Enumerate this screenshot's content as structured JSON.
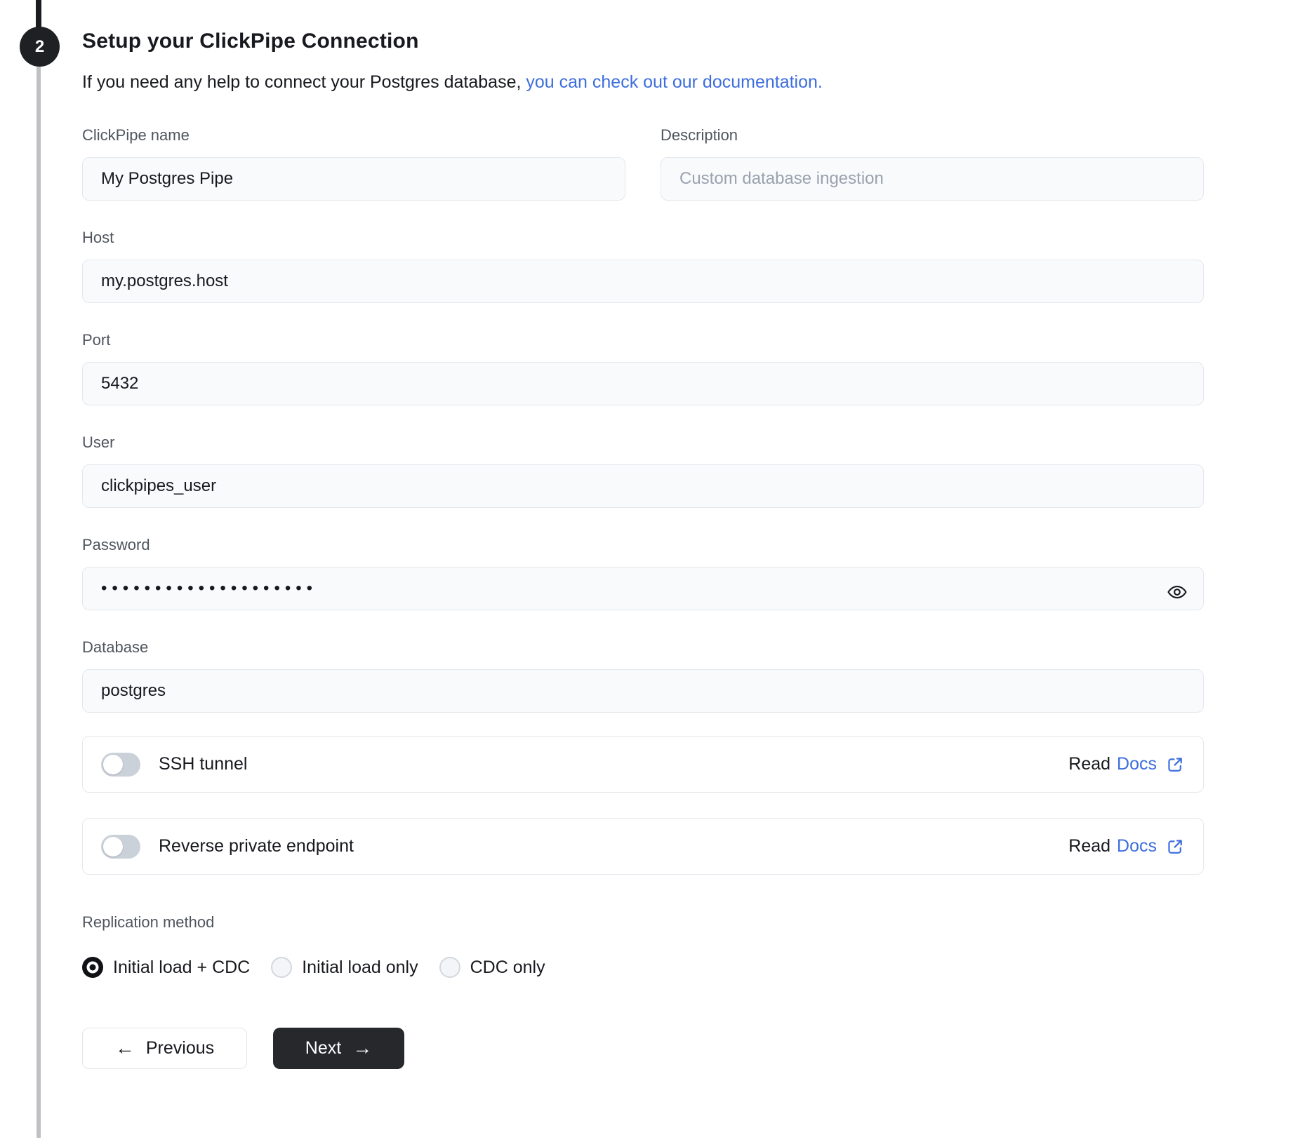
{
  "step": {
    "number": "2"
  },
  "header": {
    "title": "Setup your ClickPipe Connection",
    "subtitle_plain": "If you need any help to connect your Postgres database, ",
    "subtitle_link": "you can check out our documentation."
  },
  "form": {
    "clickpipe_name": {
      "label": "ClickPipe name",
      "value": "My Postgres Pipe"
    },
    "description": {
      "label": "Description",
      "placeholder": "Custom database ingestion"
    },
    "host": {
      "label": "Host",
      "value": "my.postgres.host"
    },
    "port": {
      "label": "Port",
      "value": "5432"
    },
    "user": {
      "label": "User",
      "value": "clickpipes_user"
    },
    "password": {
      "label": "Password",
      "masked_value": "••••••••••••••••••••",
      "reveal_icon": "eye-icon"
    },
    "database": {
      "label": "Database",
      "value": "postgres"
    }
  },
  "toggles": [
    {
      "label": "SSH tunnel",
      "state": "off",
      "read_label": "Read",
      "docs_label": "Docs",
      "icon": "external-link-icon"
    },
    {
      "label": "Reverse private endpoint",
      "state": "off",
      "read_label": "Read",
      "docs_label": "Docs",
      "icon": "external-link-icon"
    }
  ],
  "replication": {
    "label": "Replication method",
    "options": [
      {
        "label": "Initial load + CDC",
        "selected": true
      },
      {
        "label": "Initial load only",
        "selected": false
      },
      {
        "label": "CDC only",
        "selected": false
      }
    ]
  },
  "buttons": {
    "previous": {
      "label": "Previous",
      "arrow": "←"
    },
    "next": {
      "label": "Next",
      "arrow": "→"
    }
  },
  "colors": {
    "link_blue": "#3d6edd",
    "next_button": "#26282c",
    "step_circle": "#1e2023",
    "toggle_off": "#cbd1d9",
    "rail_gray": "#bfc0c3",
    "input_bg": "#f8fafc"
  }
}
